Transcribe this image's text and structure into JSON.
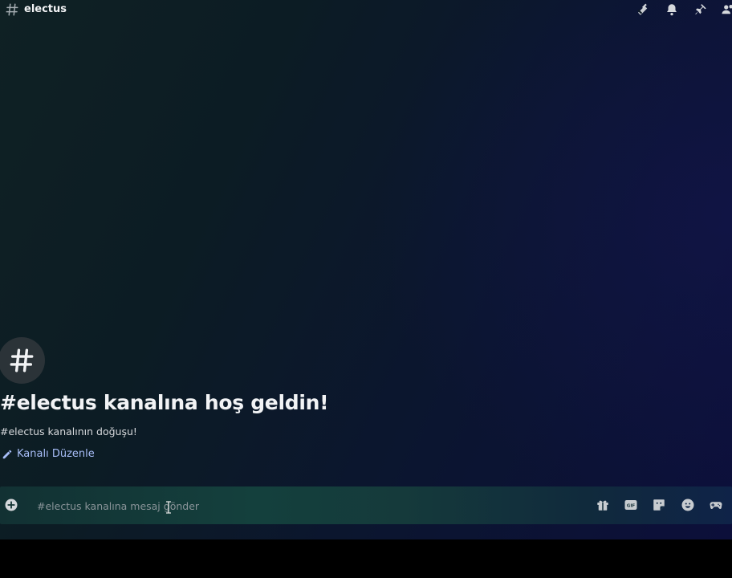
{
  "header": {
    "channel_name": "electus",
    "icons": [
      "hash-icon",
      "threads-icon",
      "bell-icon",
      "pin-icon",
      "members-icon"
    ]
  },
  "welcome": {
    "title": "#electus kanalına hoş geldin!",
    "subtitle": "#electus kanalının doğuşu!",
    "edit_label": "Kanalı Düzenle"
  },
  "composer": {
    "placeholder": "#electus kanalına mesaj gönder",
    "value": "",
    "icons": [
      "add-icon",
      "gift-icon",
      "gif-icon",
      "sticker-icon",
      "emoji-icon",
      "gamepad-icon"
    ]
  },
  "colors": {
    "link": "#a7bdf7",
    "text": "#f2f3f5"
  }
}
